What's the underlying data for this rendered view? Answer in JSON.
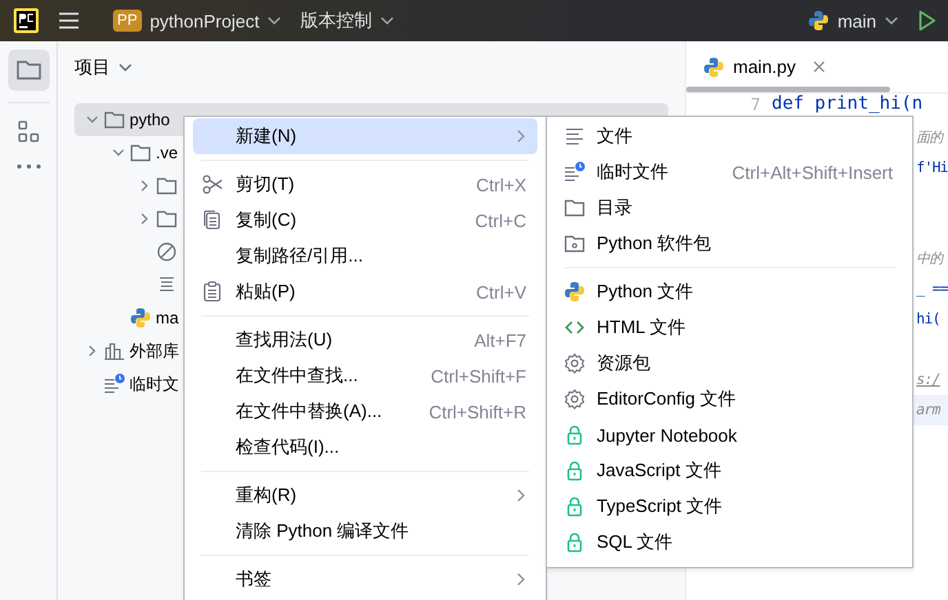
{
  "toolbar": {
    "project_badge": "PP",
    "project": "pythonProject",
    "vcs": "版本控制",
    "branch": "main"
  },
  "project_panel": {
    "title": "项目",
    "tree": [
      {
        "label": "pytho",
        "kind": "folder",
        "expanded": true,
        "selected": true,
        "children": [
          {
            "label": ".ve",
            "kind": "folder",
            "expanded": true,
            "selected": false,
            "children": [
              {
                "kind": "folder",
                "expanded": false,
                "selected": false
              },
              {
                "kind": "folder",
                "expanded": false,
                "selected": false
              },
              {
                "kind": "excluded",
                "selected": false
              },
              {
                "kind": "text",
                "selected": false
              }
            ]
          },
          {
            "label": "ma",
            "kind": "python",
            "selected": false
          }
        ]
      },
      {
        "label": "外部库",
        "kind": "library",
        "expanded": false,
        "selected": false
      },
      {
        "label": "临时文",
        "kind": "scratch",
        "selected": false
      }
    ]
  },
  "editor": {
    "tab": "main.py",
    "lines": [
      {
        "number": "7",
        "kind": "code",
        "text": "def print_hi(n"
      },
      {
        "kind": "comment",
        "text": "面的"
      },
      {
        "kind": "code",
        "text": "f'Hi"
      },
      {
        "kind": "blank"
      },
      {
        "kind": "blank"
      },
      {
        "kind": "comment",
        "text": "中的"
      },
      {
        "kind": "code",
        "text": "_ =="
      },
      {
        "kind": "code",
        "text": "hi("
      },
      {
        "kind": "blank"
      },
      {
        "kind": "link",
        "text": "s:/"
      },
      {
        "kind": "doc",
        "text": "arm"
      }
    ]
  },
  "context_menu": {
    "items": [
      {
        "kind": "plain",
        "label": "新建(N)",
        "submenu": true,
        "selected": true
      },
      {
        "kind": "separator"
      },
      {
        "kind": "scissors",
        "label": "剪切(T)",
        "shortcut": "Ctrl+X",
        "submenu": false,
        "selected": false
      },
      {
        "kind": "copy",
        "label": "复制(C)",
        "shortcut": "Ctrl+C",
        "submenu": false,
        "selected": false
      },
      {
        "kind": "plain",
        "label": "复制路径/引用...",
        "submenu": false,
        "selected": false
      },
      {
        "kind": "paste",
        "label": "粘贴(P)",
        "shortcut": "Ctrl+V",
        "submenu": false,
        "selected": false
      },
      {
        "kind": "separator"
      },
      {
        "kind": "plain",
        "label": "查找用法(U)",
        "shortcut": "Alt+F7",
        "submenu": false,
        "selected": false
      },
      {
        "kind": "plain",
        "label": "在文件中查找...",
        "shortcut": "Ctrl+Shift+F",
        "submenu": false,
        "selected": false
      },
      {
        "kind": "plain",
        "label": "在文件中替换(A)...",
        "shortcut": "Ctrl+Shift+R",
        "submenu": false,
        "selected": false
      },
      {
        "kind": "plain",
        "label": "检查代码(I)...",
        "submenu": false,
        "selected": false
      },
      {
        "kind": "separator"
      },
      {
        "kind": "plain",
        "label": "重构(R)",
        "submenu": true,
        "selected": false
      },
      {
        "kind": "plain",
        "label": "清除 Python 编译文件",
        "submenu": false,
        "selected": false
      },
      {
        "kind": "separator"
      },
      {
        "kind": "plain",
        "label": "书签",
        "submenu": true,
        "selected": false
      }
    ]
  },
  "submenu": {
    "items": [
      {
        "kind": "text",
        "label": "文件"
      },
      {
        "kind": "scratch",
        "label": "临时文件",
        "shortcut": "Ctrl+Alt+Shift+Insert"
      },
      {
        "kind": "folder",
        "label": "目录"
      },
      {
        "kind": "package",
        "label": "Python 软件包"
      },
      {
        "kind": "separator"
      },
      {
        "kind": "python",
        "label": "Python 文件"
      },
      {
        "kind": "html",
        "label": "HTML 文件"
      },
      {
        "kind": "gear",
        "label": "资源包"
      },
      {
        "kind": "gear",
        "label": "EditorConfig 文件"
      },
      {
        "kind": "lock",
        "label": "Jupyter Notebook"
      },
      {
        "kind": "lock",
        "label": "JavaScript 文件"
      },
      {
        "kind": "lock",
        "label": "TypeScript 文件"
      },
      {
        "kind": "lock",
        "label": "SQL 文件"
      }
    ]
  }
}
